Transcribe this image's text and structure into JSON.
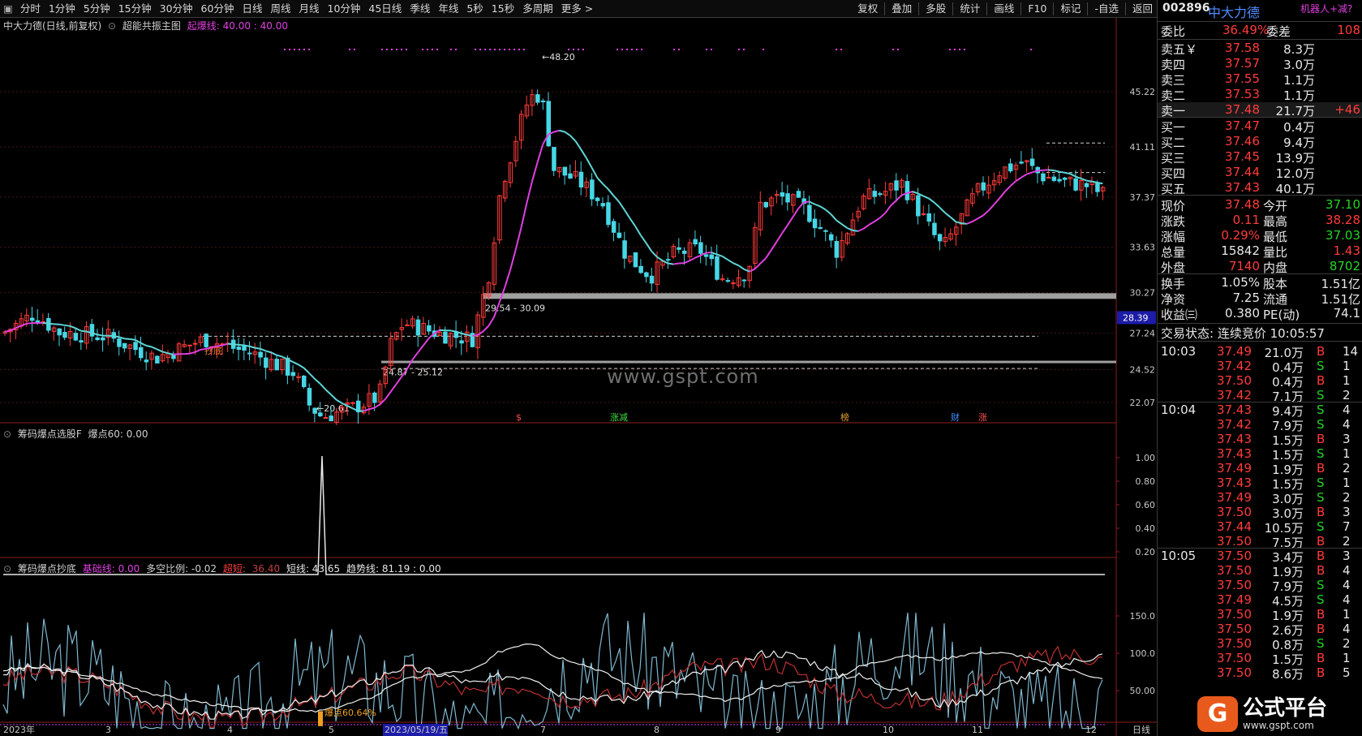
{
  "toolbar": {
    "periods": [
      "分时",
      "1分钟",
      "5分钟",
      "15分钟",
      "30分钟",
      "60分钟",
      "日线",
      "周线",
      "月线",
      "10分钟",
      "45日线",
      "季线",
      "年线",
      "5秒",
      "15秒",
      "多周期",
      "更多 >"
    ],
    "right": [
      "复权",
      "叠加",
      "多股",
      "统计",
      "画线",
      "F10",
      "标记",
      "-自选",
      "返回"
    ]
  },
  "main": {
    "title": "中大力德(日线,前复权)",
    "indicator": "超能共振主图",
    "signal_label": "起爆线: 40.00 : 40.00",
    "price_axis": [
      "45.22",
      "41.11",
      "37.37",
      "33.63",
      "30.27",
      "27.24",
      "24.52",
      "22.07"
    ],
    "current_tag": "28.39",
    "high_label": "48.20",
    "low_label": "20.61",
    "zone_upper": "29.54 - 30.09",
    "zone_lower": "24.87 - 25.12",
    "buy_label": "抄底",
    "events": [
      "$",
      "涨减",
      "榜",
      "财",
      "涨"
    ]
  },
  "panel2": {
    "title": "筹码爆点选股F",
    "value": "爆点60: 0.00",
    "axis": [
      "1.00",
      "0.80",
      "0.60",
      "0.40",
      "0.20"
    ]
  },
  "panel3": {
    "title": "筹码爆点抄底",
    "base": "基础线: 0.00",
    "ratio": "多空比例: -0.02",
    "ultra_lbl": "超短:",
    "ultra_val": "36.40",
    "short": "短线: 43.65",
    "trend": "趋势线: 81.19 : 0.00",
    "axis": [
      "150.0",
      "100.0",
      "50.00"
    ],
    "bao_label": "爆点60.64%"
  },
  "xaxis": {
    "labels": [
      "2023年",
      "3",
      "4",
      "5",
      "2023/05/19/五",
      "7",
      "8",
      "9",
      "10",
      "11",
      "12"
    ],
    "right": "日线"
  },
  "watermark": "www.gspt.com",
  "quote": {
    "code": "002896",
    "name": "中大力德",
    "robot": "机器人+减?",
    "wb_label": "委比",
    "wb_val": "36.49%",
    "wc_label": "委差",
    "wc_val": "108",
    "asks": [
      {
        "l": "卖五￥",
        "p": "37.58",
        "v": "8.3万"
      },
      {
        "l": "卖四",
        "p": "37.57",
        "v": "3.0万"
      },
      {
        "l": "卖三",
        "p": "37.55",
        "v": "1.1万"
      },
      {
        "l": "卖二",
        "p": "37.53",
        "v": "1.1万"
      },
      {
        "l": "卖一",
        "p": "37.48",
        "v": "21.7万",
        "d": "+46"
      }
    ],
    "bids": [
      {
        "l": "买一",
        "p": "37.47",
        "v": "0.4万"
      },
      {
        "l": "买二",
        "p": "37.46",
        "v": "9.4万"
      },
      {
        "l": "买三",
        "p": "37.45",
        "v": "13.9万"
      },
      {
        "l": "买四",
        "p": "37.44",
        "v": "12.0万"
      },
      {
        "l": "买五",
        "p": "37.43",
        "v": "40.1万"
      }
    ],
    "stats": [
      {
        "a": "现价",
        "av": "37.48",
        "b": "今开",
        "bv": "37.10"
      },
      {
        "a": "涨跌",
        "av": "0.11",
        "b": "最高",
        "bv": "38.28"
      },
      {
        "a": "涨幅",
        "av": "0.29%",
        "b": "最低",
        "bv": "37.03"
      },
      {
        "a": "总量",
        "av": "15842",
        "b": "量比",
        "bv": "1.43"
      },
      {
        "a": "外盘",
        "av": "7140",
        "b": "内盘",
        "bv": "8702"
      }
    ],
    "info": [
      {
        "a": "换手",
        "av": "1.05%",
        "b": "股本",
        "bv": "1.51亿"
      },
      {
        "a": "净资",
        "av": "7.25",
        "b": "流通",
        "bv": "1.51亿"
      },
      {
        "a": "收益㈢",
        "av": "0.380",
        "b": "PE(动)",
        "bv": "74.1"
      }
    ],
    "status": "交易状态: 连续竞价 10:05:57",
    "ticks": [
      {
        "t": "10:03",
        "p": "37.49",
        "v": "21.0万",
        "s": "B",
        "n": "14"
      },
      {
        "t": "",
        "p": "37.42",
        "v": "0.4万",
        "s": "S",
        "n": "1"
      },
      {
        "t": "",
        "p": "37.50",
        "v": "0.4万",
        "s": "B",
        "n": "1"
      },
      {
        "t": "",
        "p": "37.42",
        "v": "7.1万",
        "s": "S",
        "n": "2"
      },
      {
        "t": "10:04",
        "p": "37.43",
        "v": "9.4万",
        "s": "S",
        "n": "4"
      },
      {
        "t": "",
        "p": "37.42",
        "v": "7.9万",
        "s": "S",
        "n": "4"
      },
      {
        "t": "",
        "p": "37.43",
        "v": "1.5万",
        "s": "B",
        "n": "3"
      },
      {
        "t": "",
        "p": "37.43",
        "v": "1.5万",
        "s": "S",
        "n": "1"
      },
      {
        "t": "",
        "p": "37.49",
        "v": "1.9万",
        "s": "B",
        "n": "2"
      },
      {
        "t": "",
        "p": "37.43",
        "v": "1.5万",
        "s": "S",
        "n": "1"
      },
      {
        "t": "",
        "p": "37.49",
        "v": "3.0万",
        "s": "S",
        "n": "2"
      },
      {
        "t": "",
        "p": "37.50",
        "v": "3.0万",
        "s": "B",
        "n": "3"
      },
      {
        "t": "",
        "p": "37.44",
        "v": "10.5万",
        "s": "S",
        "n": "7"
      },
      {
        "t": "",
        "p": "37.50",
        "v": "7.5万",
        "s": "B",
        "n": "2"
      },
      {
        "t": "10:05",
        "p": "37.50",
        "v": "3.4万",
        "s": "B",
        "n": "3"
      },
      {
        "t": "",
        "p": "37.50",
        "v": "1.9万",
        "s": "B",
        "n": "4"
      },
      {
        "t": "",
        "p": "37.50",
        "v": "7.9万",
        "s": "S",
        "n": "4"
      },
      {
        "t": "",
        "p": "37.49",
        "v": "4.5万",
        "s": "S",
        "n": "4"
      },
      {
        "t": "",
        "p": "37.50",
        "v": "1.9万",
        "s": "B",
        "n": "1"
      },
      {
        "t": "",
        "p": "37.50",
        "v": "2.6万",
        "s": "B",
        "n": "4"
      },
      {
        "t": "",
        "p": "37.50",
        "v": "0.8万",
        "s": "S",
        "n": "2"
      },
      {
        "t": "",
        "p": "37.50",
        "v": "1.5万",
        "s": "B",
        "n": "1"
      },
      {
        "t": "",
        "p": "37.50",
        "v": "8.6万",
        "s": "B",
        "n": "5"
      }
    ]
  },
  "logo": {
    "text": "公式平台",
    "url": "www.gspt.com"
  },
  "colors": {
    "up": "#ff3b3b",
    "down": "#46d7e6",
    "ma_up": "#e040e0",
    "ma_down": "#5fd6d6"
  }
}
